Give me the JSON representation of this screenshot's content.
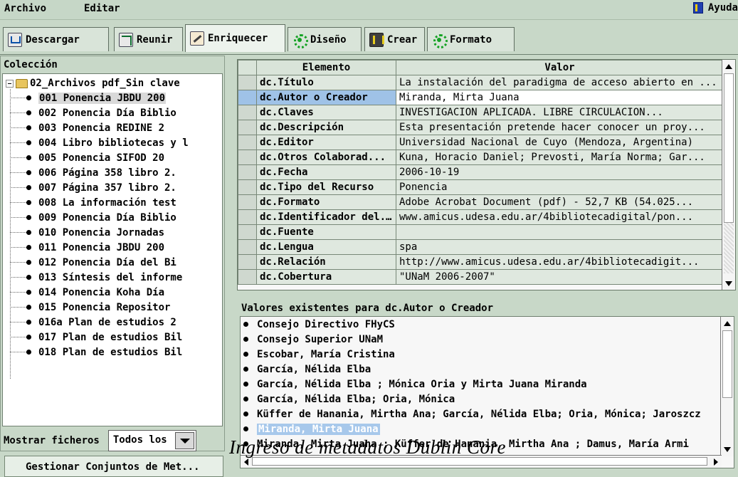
{
  "menu": {
    "archivo": "Archivo",
    "editar": "Editar",
    "ayuda": "Ayuda"
  },
  "tabs": [
    {
      "label": "Descargar",
      "icon": "download-icon"
    },
    {
      "label": "Reunir",
      "icon": "gather-icon"
    },
    {
      "label": "Enriquecer",
      "icon": "enrich-icon",
      "active": true
    },
    {
      "label": "Diseño",
      "icon": "design-gear-icon"
    },
    {
      "label": "Crear",
      "icon": "create-icon"
    },
    {
      "label": "Formato",
      "icon": "format-gear-icon"
    }
  ],
  "collection": {
    "title": "Colección",
    "root_label": "02_Archivos pdf_Sin clave",
    "items": [
      "001 Ponencia JBDU 200",
      "002 Ponencia Día Biblio",
      "003 Ponencia REDINE 2",
      "004 Libro bibliotecas y l",
      "005 Ponencia SIFOD 20",
      "006 Página 358 libro 2.",
      "007 Página 357 libro 2.",
      "008 La información test",
      "009 Ponencia Día Biblio",
      "010 Ponencia Jornadas",
      "011 Ponencia JBDU 200",
      "012 Ponencia Día del Bi",
      "013 Síntesis del informe",
      "014 Ponencia Koha Día",
      "015 Ponencia Repositor",
      "016a Plan de estudios 2",
      "017 Plan de estudios Bil",
      "018 Plan de estudios Bil"
    ],
    "selected_index": 0,
    "show_files_label": "Mostrar ficheros",
    "show_files_value": "Todos los",
    "manage_button": "Gestionar Conjuntos de Met..."
  },
  "metadata_table": {
    "headers": {
      "element": "Elemento",
      "value": "Valor"
    },
    "rows": [
      {
        "element": "dc.Título",
        "value": "La instalación del paradigma de acceso abierto en ..."
      },
      {
        "element": "dc.Autor o Creador",
        "value": "Miranda, Mirta Juana",
        "selected": true
      },
      {
        "element": "dc.Claves",
        "value": "INVESTIGACION APLICADA. LIBRE CIRCULACION..."
      },
      {
        "element": "dc.Descripción",
        "value": "Esta presentación pretende hacer conocer un proy..."
      },
      {
        "element": "dc.Editor",
        "value": "Universidad Nacional de Cuyo (Mendoza, Argentina)"
      },
      {
        "element": "dc.Otros Colaborad...",
        "value": "Kuna, Horacio Daniel; Prevosti, María Norma; Gar..."
      },
      {
        "element": "dc.Fecha",
        "value": "2006-10-19"
      },
      {
        "element": "dc.Tipo del Recurso",
        "value": "Ponencia"
      },
      {
        "element": "dc.Formato",
        "value": "Adobe Acrobat Document (pdf) - 52,7 KB (54.025..."
      },
      {
        "element": "dc.Identificador del...",
        "value": "www.amicus.udesa.edu.ar/4bibliotecadigital/pon..."
      },
      {
        "element": "dc.Fuente",
        "value": ""
      },
      {
        "element": "dc.Lengua",
        "value": "spa"
      },
      {
        "element": "dc.Relación",
        "value": "http://www.amicus.udesa.edu.ar/4bibliotecadigit..."
      },
      {
        "element": "dc.Cobertura",
        "value": "\"UNaM 2006-2007\""
      }
    ]
  },
  "existing_values": {
    "title": "Valores existentes para dc.Autor o Creador",
    "items": [
      "Consejo Directivo FHyCS",
      "Consejo Superior UNaM",
      "Escobar, María Cristina",
      "García, Nélida Elba",
      "García, Nélida Elba ; Mónica Oria y Mirta Juana Miranda",
      "García, Nélida Elba; Oria, Mónica",
      "Küffer de Hanania, Mirtha Ana; García, Nélida Elba; Oria, Mónica; Jaroszcz",
      "Miranda, Mirta Juana",
      "Miranda, Mirta Juana ; Küffer de Hanania, Mirtha Ana ; Damus, María Armi"
    ],
    "selected_index": 7
  },
  "caption": "Ingreso de metadatos Dublin Core"
}
